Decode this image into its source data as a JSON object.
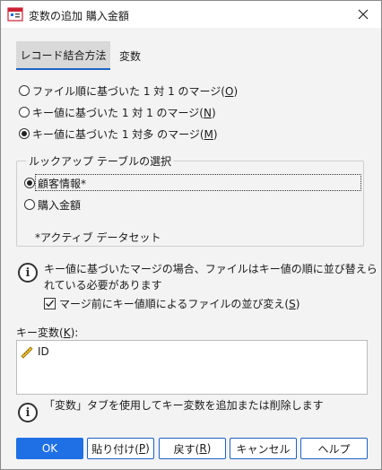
{
  "window": {
    "title": "変数の追加 購入金額"
  },
  "tabs": [
    {
      "label": "レコード結合方法",
      "active": true
    },
    {
      "label": "変数",
      "active": false
    }
  ],
  "merge_methods": [
    {
      "label": "ファイル順に基づいた 1 対 1 のマージ(",
      "key": "O",
      "tail": ")",
      "selected": false
    },
    {
      "label": "キー値に基づいた 1 対 1 のマージ(",
      "key": "N",
      "tail": ")",
      "selected": false
    },
    {
      "label": "キー値に基づいた 1 対多 のマージ(",
      "key": "M",
      "tail": ")",
      "selected": true
    }
  ],
  "lookup": {
    "title": "ルックアップ テーブルの選択",
    "options": [
      {
        "label": "顧客情報*",
        "selected": true
      },
      {
        "label": "購入金額",
        "selected": false
      }
    ],
    "note": "*アクティブ データセット"
  },
  "info1": {
    "line1": "キー値に基づいたマージの場合、ファイルはキー値の順に並び替えら",
    "line2": "れている必要があります"
  },
  "sort_checkbox": {
    "label": "マージ前にキー値順によるファイルの並び変え(",
    "key": "S",
    "tail": ")",
    "checked": true
  },
  "key_vars": {
    "label_prefix": "キー変数(",
    "label_key": "K",
    "label_tail": "):",
    "items": [
      {
        "name": "ID",
        "icon": "ruler-icon"
      }
    ]
  },
  "info2": {
    "text": "「変数」タブを使用してキー変数を追加または削除します"
  },
  "buttons": {
    "ok": "OK",
    "paste_prefix": "貼り付け(",
    "paste_key": "P",
    "paste_tail": ")",
    "reset_prefix": "戻す(",
    "reset_key": "R",
    "reset_tail": ")",
    "cancel": "キャンセル",
    "help": "ヘルプ"
  },
  "colors": {
    "accent": "#1f6fe5",
    "tab_underline": "#1e63c7"
  }
}
